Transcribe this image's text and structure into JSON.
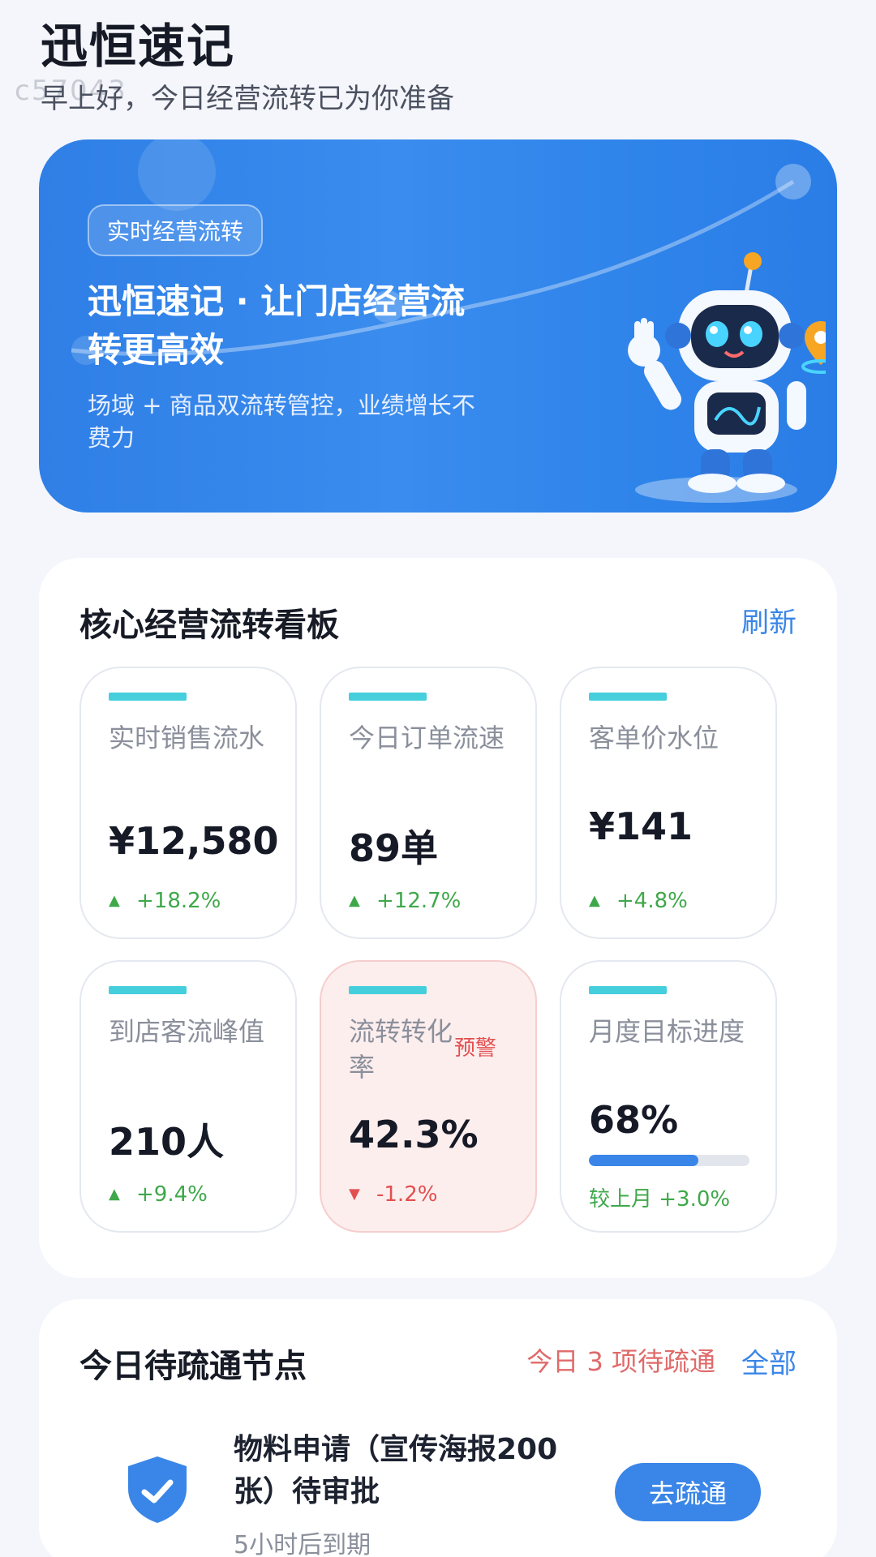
{
  "header": {
    "app_title": "迅恒速记",
    "watermark": "c57043",
    "greeting": "早上好，今日经营流转已为你准备"
  },
  "hero": {
    "badge": "实时经营流转",
    "title": "迅恒速记 · 让门店经营流转更高效",
    "subtitle": "场域 + 商品双流转管控，业绩增长不费力",
    "illustration": "robot-mascot-with-location-pin",
    "colors": {
      "background": "#3a8cee"
    }
  },
  "dashboard": {
    "title": "核心经营流转看板",
    "refresh_label": "刷新",
    "metrics": [
      {
        "label": "实时销售流水",
        "value": "¥12,580",
        "delta": "+18.2%",
        "trend": "up"
      },
      {
        "label": "今日订单流速",
        "value": "89单",
        "delta": "+12.7%",
        "trend": "up"
      },
      {
        "label": "客单价水位",
        "value": "¥141",
        "delta": "+4.8%",
        "trend": "up"
      },
      {
        "label": "到店客流峰值",
        "value": "210人",
        "delta": "+9.4%",
        "trend": "up"
      },
      {
        "label": "流转转化率",
        "value": "42.3%",
        "delta": "-1.2%",
        "trend": "down",
        "warning": "预警"
      },
      {
        "label": "月度目标进度",
        "value": "68%",
        "progress": 0.68,
        "note": "较上月 +3.0%"
      }
    ],
    "colors": {
      "up": "#3fa84a",
      "down": "#e24f4f",
      "accent": "#45cfdc"
    }
  },
  "pending": {
    "title": "今日待疏通节点",
    "count_text": "今日 3 项待疏通",
    "all_label": "全部",
    "item": {
      "icon": "shield-check-icon",
      "title": "物料申请（宣传海报200张）待审批",
      "time": "5小时后到期",
      "action": "去疏通"
    }
  }
}
